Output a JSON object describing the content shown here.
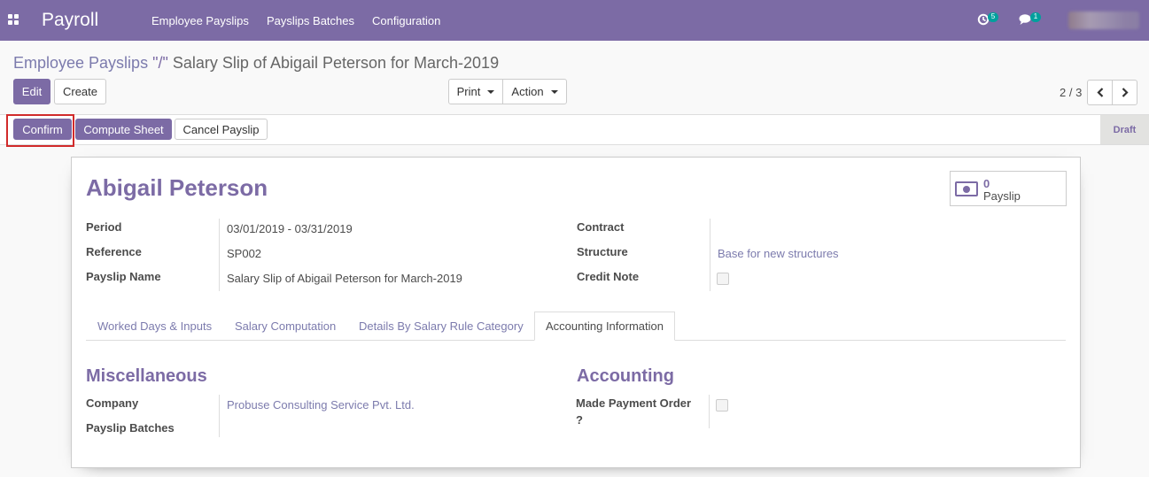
{
  "navbar": {
    "app_title": "Payroll",
    "menu": [
      "Employee Payslips",
      "Payslips Batches",
      "Configuration"
    ],
    "activity_count": "5",
    "messages_count": "1"
  },
  "breadcrumb": {
    "parent": "Employee Payslips",
    "separator": "\"/\"",
    "current": "Salary Slip of Abigail Peterson for March-2019"
  },
  "buttons": {
    "edit": "Edit",
    "create": "Create",
    "print": "Print",
    "action": "Action"
  },
  "pager": {
    "text": "2 / 3"
  },
  "statusbar": {
    "confirm": "Confirm",
    "compute_sheet": "Compute Sheet",
    "cancel_payslip": "Cancel Payslip",
    "state": "Draft"
  },
  "sheet": {
    "employee_name": "Abigail Peterson",
    "smart_button": {
      "value": "0",
      "label": "Payslip"
    },
    "left_fields": [
      {
        "label": "Period",
        "value": "03/01/2019 - 03/31/2019"
      },
      {
        "label": "Reference",
        "value": "SP002"
      },
      {
        "label": "Payslip Name",
        "value": "Salary Slip of Abigail Peterson for March-2019"
      }
    ],
    "right_fields": [
      {
        "label": "Contract",
        "value": ""
      },
      {
        "label": "Structure",
        "value": "Base for new structures"
      },
      {
        "label": "Credit Note",
        "value": false
      }
    ],
    "tabs": [
      "Worked Days & Inputs",
      "Salary Computation",
      "Details By Salary Rule Category",
      "Accounting Information"
    ],
    "active_tab": "Accounting Information",
    "misc": {
      "title": "Miscellaneous",
      "company_label": "Company",
      "company_value": "Probuse Consulting Service Pvt. Ltd.",
      "batches_label": "Payslip Batches",
      "batches_value": ""
    },
    "accounting": {
      "title": "Accounting",
      "made_payment_label_1": "Made Payment Order",
      "made_payment_label_2": "?",
      "made_payment_value": false
    }
  },
  "colors": {
    "brand": "#7c6ba5",
    "link": "#7c7bad",
    "badge": "#00a09d",
    "highlight": "#d12b2b"
  }
}
